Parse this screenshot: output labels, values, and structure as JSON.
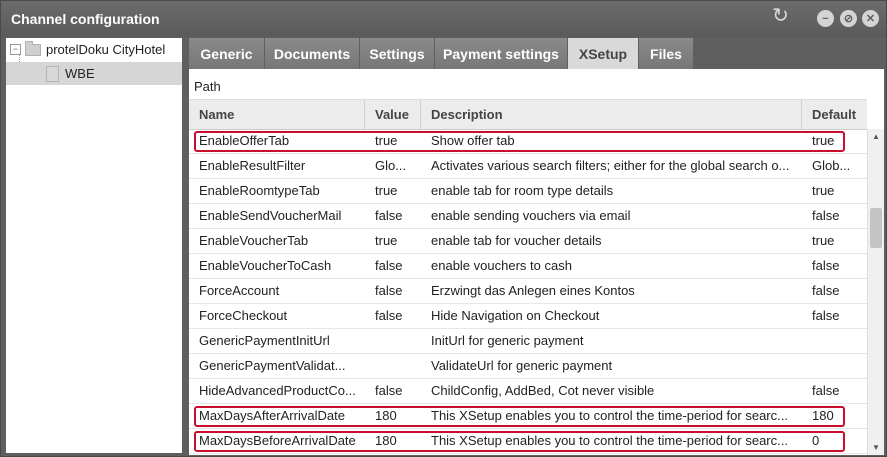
{
  "window": {
    "title": "Channel configuration"
  },
  "icons": {
    "refresh": "refresh-icon",
    "minimize": "minimize-icon",
    "maximize": "maximize-icon",
    "close": "close-icon"
  },
  "tree": {
    "root": "protelDoku CityHotel",
    "child": "WBE"
  },
  "tabs": [
    "Generic",
    "Documents",
    "Settings",
    "Payment settings",
    "XSetup",
    "Files"
  ],
  "active_tab": "XSetup",
  "path_label": "Path",
  "columns": {
    "name": "Name",
    "value": "Value",
    "description": "Description",
    "default": "Default"
  },
  "rows": [
    {
      "name": "EnableOfferTab",
      "value": "true",
      "description": "Show offer tab",
      "default": "true",
      "highlighted": true
    },
    {
      "name": "EnableResultFilter",
      "value": "Glo...",
      "description": "Activates various search filters; either for the global search o...",
      "default": "Glob...",
      "highlighted": false
    },
    {
      "name": "EnableRoomtypeTab",
      "value": "true",
      "description": "enable tab for room type details",
      "default": "true",
      "highlighted": false
    },
    {
      "name": "EnableSendVoucherMail",
      "value": "false",
      "description": "enable sending vouchers via email",
      "default": "false",
      "highlighted": false
    },
    {
      "name": "EnableVoucherTab",
      "value": "true",
      "description": "enable tab for voucher details",
      "default": "true",
      "highlighted": false
    },
    {
      "name": "EnableVoucherToCash",
      "value": "false",
      "description": "enable vouchers to cash",
      "default": "false",
      "highlighted": false
    },
    {
      "name": "ForceAccount",
      "value": "false",
      "description": "Erzwingt das Anlegen eines Kontos",
      "default": "false",
      "highlighted": false
    },
    {
      "name": "ForceCheckout",
      "value": "false",
      "description": "Hide Navigation on Checkout",
      "default": "false",
      "highlighted": false
    },
    {
      "name": "GenericPaymentInitUrl",
      "value": "",
      "description": "InitUrl for generic payment",
      "default": "",
      "highlighted": false
    },
    {
      "name": "GenericPaymentValidat...",
      "value": "",
      "description": "ValidateUrl for generic payment",
      "default": "",
      "highlighted": false
    },
    {
      "name": "HideAdvancedProductCo...",
      "value": "false",
      "description": "ChildConfig, AddBed, Cot never visible",
      "default": "false",
      "highlighted": false
    },
    {
      "name": "MaxDaysAfterArrivalDate",
      "value": "180",
      "description": "This XSetup enables you to control the time-period for searc...",
      "default": "180",
      "highlighted": true
    },
    {
      "name": "MaxDaysBeforeArrivalDate",
      "value": "180",
      "description": "This XSetup enables you to control the time-period for searc...",
      "default": "0",
      "highlighted": true
    }
  ],
  "colors": {
    "title_bg": "#5f5f5f",
    "tab_bg": "#7f7f7f",
    "active_tab_bg": "#d9d9d9",
    "highlight": "#c8102e",
    "tree_selected": "#d6d6d6"
  }
}
